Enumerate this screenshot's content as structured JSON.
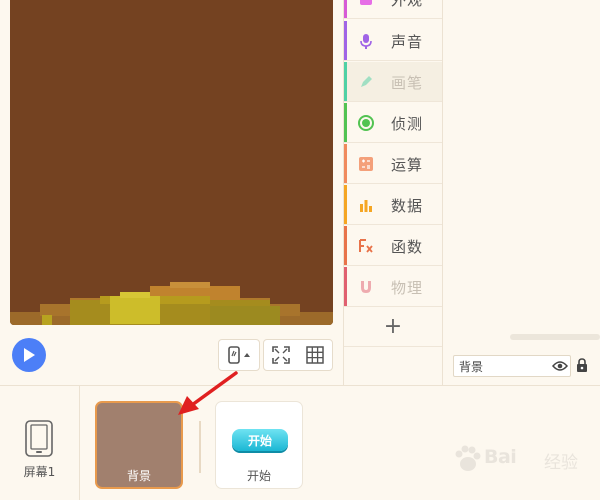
{
  "stage": {
    "background_color": "#744221"
  },
  "toolbar": {
    "play_icon": "play-icon",
    "device_icon": "phone-rotate-icon",
    "fullscreen_icon": "fullscreen-icon",
    "grid_icon": "grid-icon"
  },
  "categories": [
    {
      "label": "外观",
      "color": "#d65ad6",
      "icon": "looks-icon",
      "dim": false,
      "selected": false
    },
    {
      "label": "声音",
      "color": "#a064e6",
      "icon": "microphone-icon",
      "dim": false,
      "selected": false
    },
    {
      "label": "画笔",
      "color": "#4fd1a5",
      "icon": "pen-icon",
      "dim": true,
      "selected": true
    },
    {
      "label": "侦测",
      "color": "#52c352",
      "icon": "sensing-icon",
      "dim": false,
      "selected": false
    },
    {
      "label": "运算",
      "color": "#f08a5d",
      "icon": "operators-icon",
      "dim": false,
      "selected": false
    },
    {
      "label": "数据",
      "color": "#f5a623",
      "icon": "data-icon",
      "dim": false,
      "selected": false
    },
    {
      "label": "函数",
      "color": "#e8734a",
      "icon": "function-icon",
      "dim": false,
      "selected": false
    },
    {
      "label": "物理",
      "color": "#e06070",
      "icon": "physics-magnet-icon",
      "dim": true,
      "selected": false
    }
  ],
  "add_category_label": "+",
  "sprite_name": {
    "value": "背景"
  },
  "screen": {
    "label": "屏幕1"
  },
  "sprites": [
    {
      "label": "背景",
      "selected": true
    },
    {
      "label": "开始",
      "thumb_text": "开始",
      "selected": false
    }
  ],
  "watermark": {
    "text": "Bai",
    "text2": "经验"
  }
}
